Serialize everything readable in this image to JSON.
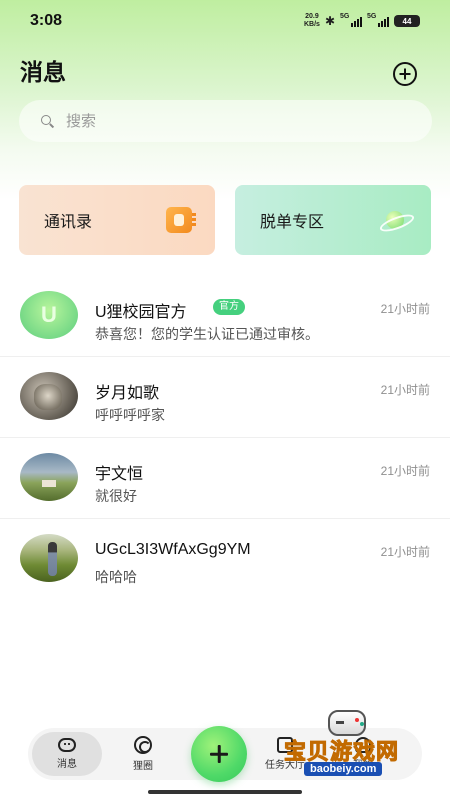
{
  "status_bar": {
    "time": "3:08",
    "net_speed_value": "20.9",
    "net_speed_unit": "KB/s",
    "signal1_label": "5G",
    "signal2_label": "5G",
    "battery": "44"
  },
  "header": {
    "title": "消息"
  },
  "search": {
    "placeholder": "搜索",
    "value": ""
  },
  "quick_cards": {
    "contacts_label": "通讯录",
    "single_zone_label": "脱单专区"
  },
  "messages": [
    {
      "name": "U狸校园官方",
      "badge": "官方",
      "preview": "恭喜您！您的学生认证已通过审核。",
      "time": "21小时前",
      "avatar_letter": "U"
    },
    {
      "name": "岁月如歌",
      "preview": "呼呼呼呼家",
      "time": "21小时前"
    },
    {
      "name": "宇文恒",
      "preview": "就很好",
      "time": "21小时前"
    },
    {
      "name": "UGcL3I3WfAxGg9YM",
      "preview": "哈哈哈",
      "time": "21小时前"
    }
  ],
  "bottom_nav": {
    "messages_label": "消息",
    "circle_label": "狸圈",
    "tasks_label": "任务大厅",
    "mine_label": "我的"
  },
  "watermark": {
    "text": "宝贝游戏网",
    "url": "baobeiy.com"
  },
  "colors": {
    "accent_green": "#45d07e",
    "header_gradient_top": "#bfeea0",
    "contacts_card": "#fbd9c1",
    "single_zone_card": "#a8ecc3"
  },
  "icons": {
    "add": "plus-circle-icon",
    "search": "search-icon",
    "contacts": "address-book-icon",
    "single_zone": "planet-icon",
    "nav_messages": "chat-bubble-icon",
    "nav_circle": "circle-icon",
    "nav_add": "plus-icon"
  }
}
